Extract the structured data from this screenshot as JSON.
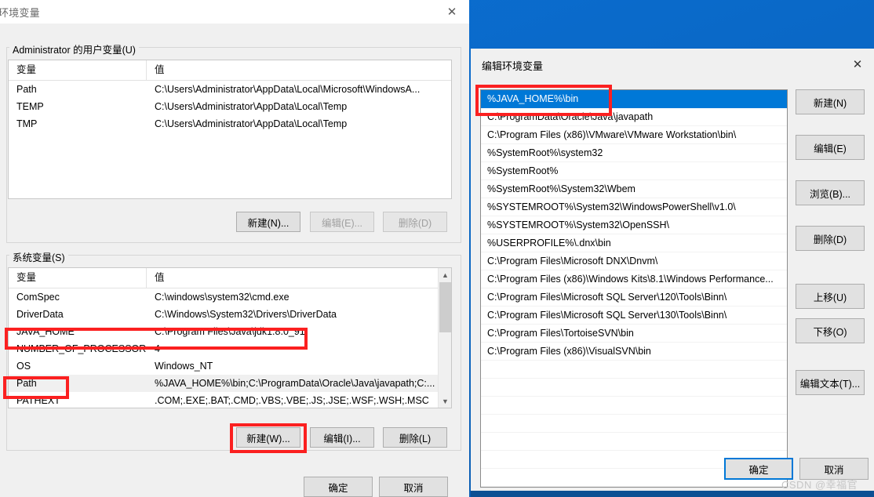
{
  "desktop": {
    "background_color": "#0a6ed1"
  },
  "env_dialog": {
    "title": "环境变量",
    "close_label": "✕",
    "user_group_label": "Administrator 的用户变量(U)",
    "system_group_label": "系统变量(S)",
    "columns": {
      "variable": "变量",
      "value": "值"
    },
    "user_variables": [
      {
        "name": "Path",
        "value": "C:\\Users\\Administrator\\AppData\\Local\\Microsoft\\WindowsA..."
      },
      {
        "name": "TEMP",
        "value": "C:\\Users\\Administrator\\AppData\\Local\\Temp"
      },
      {
        "name": "TMP",
        "value": "C:\\Users\\Administrator\\AppData\\Local\\Temp"
      }
    ],
    "user_buttons": [
      {
        "label": "新建(N)...",
        "enabled": true
      },
      {
        "label": "编辑(E)...",
        "enabled": false
      },
      {
        "label": "删除(D)",
        "enabled": false
      }
    ],
    "system_variables": [
      {
        "name": "ComSpec",
        "value": "C:\\windows\\system32\\cmd.exe",
        "selected": false
      },
      {
        "name": "DriverData",
        "value": "C:\\Windows\\System32\\Drivers\\DriverData",
        "selected": false
      },
      {
        "name": "JAVA_HOME",
        "value": "C:\\Program Files\\Java\\jdk1.8.0_91",
        "selected": false
      },
      {
        "name": "NUMBER_OF_PROCESSORS",
        "value": "4",
        "selected": false
      },
      {
        "name": "OS",
        "value": "Windows_NT",
        "selected": false
      },
      {
        "name": "Path",
        "value": "%JAVA_HOME%\\bin;C:\\ProgramData\\Oracle\\Java\\javapath;C:...",
        "selected": true
      },
      {
        "name": "PATHEXT",
        "value": ".COM;.EXE;.BAT;.CMD;.VBS;.VBE;.JS;.JSE;.WSF;.WSH;.MSC",
        "selected": false
      }
    ],
    "system_buttons": [
      {
        "label": "新建(W)...",
        "enabled": true
      },
      {
        "label": "编辑(I)...",
        "enabled": true
      },
      {
        "label": "删除(L)",
        "enabled": true
      }
    ],
    "ok_label": "确定",
    "cancel_label": "取消"
  },
  "edit_dialog": {
    "title": "编辑环境变量",
    "close_label": "✕",
    "path_entries": [
      {
        "text": "%JAVA_HOME%\\bin",
        "selected": true
      },
      {
        "text": "C:\\ProgramData\\Oracle\\Java\\javapath",
        "selected": false
      },
      {
        "text": "C:\\Program Files (x86)\\VMware\\VMware Workstation\\bin\\",
        "selected": false
      },
      {
        "text": "%SystemRoot%\\system32",
        "selected": false
      },
      {
        "text": "%SystemRoot%",
        "selected": false
      },
      {
        "text": "%SystemRoot%\\System32\\Wbem",
        "selected": false
      },
      {
        "text": "%SYSTEMROOT%\\System32\\WindowsPowerShell\\v1.0\\",
        "selected": false
      },
      {
        "text": "%SYSTEMROOT%\\System32\\OpenSSH\\",
        "selected": false
      },
      {
        "text": "%USERPROFILE%\\.dnx\\bin",
        "selected": false
      },
      {
        "text": "C:\\Program Files\\Microsoft DNX\\Dnvm\\",
        "selected": false
      },
      {
        "text": "C:\\Program Files (x86)\\Windows Kits\\8.1\\Windows Performance...",
        "selected": false
      },
      {
        "text": "C:\\Program Files\\Microsoft SQL Server\\120\\Tools\\Binn\\",
        "selected": false
      },
      {
        "text": "C:\\Program Files\\Microsoft SQL Server\\130\\Tools\\Binn\\",
        "selected": false
      },
      {
        "text": "C:\\Program Files\\TortoiseSVN\\bin",
        "selected": false
      },
      {
        "text": "C:\\Program Files (x86)\\VisualSVN\\bin",
        "selected": false
      }
    ],
    "side_buttons": [
      {
        "label": "新建(N)"
      },
      {
        "label": "编辑(E)"
      },
      {
        "label": "浏览(B)..."
      },
      {
        "label": "删除(D)"
      },
      {
        "label": "上移(U)"
      },
      {
        "label": "下移(O)"
      },
      {
        "label": "编辑文本(T)..."
      }
    ],
    "ok_label": "确定",
    "cancel_label": "取消"
  },
  "watermark": {
    "text": "CSDN @幸福官"
  },
  "annotations": {
    "color": "#fb2020"
  }
}
